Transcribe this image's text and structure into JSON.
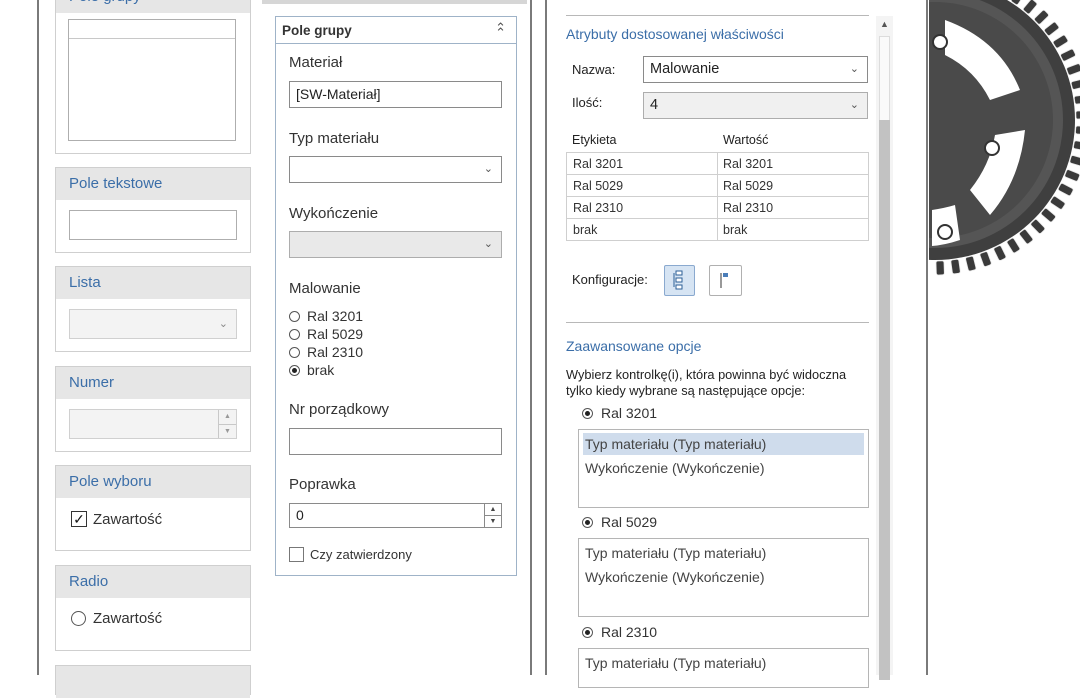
{
  "left_palette": {
    "group_title": "Pole grupy",
    "textbox_title": "Pole tekstowe",
    "list_title": "Lista",
    "number_title": "Numer",
    "checkbox_title": "Pole wyboru",
    "checkbox_label": "Zawartość",
    "radio_title": "Radio",
    "radio_label": "Zawartość"
  },
  "group": {
    "title": "Pole grupy",
    "material_label": "Materiał",
    "material_value": "[SW-Materiał]",
    "material_type_label": "Typ materiału",
    "material_type_value": "",
    "finish_label": "Wykończenie",
    "finish_value": "",
    "painting_label": "Malowanie",
    "painting_options": [
      "Ral 3201",
      "Ral 5029",
      "Ral 2310",
      "brak"
    ],
    "painting_selected": "brak",
    "order_label": "Nr porządkowy",
    "order_value": "",
    "revision_label": "Poprawka",
    "revision_value": "0",
    "approved_label": "Czy zatwierdzony"
  },
  "properties": {
    "attributes_title": "Atrybuty dostosowanej właściwości",
    "name_label": "Nazwa:",
    "name_value": "Malowanie",
    "count_label": "Ilość:",
    "count_value": "4",
    "table_headers": [
      "Etykieta",
      "Wartość"
    ],
    "table_rows": [
      [
        "Ral 3201",
        "Ral 3201"
      ],
      [
        "Ral 5029",
        "Ral 5029"
      ],
      [
        "Ral 2310",
        "Ral 2310"
      ],
      [
        "brak",
        "brak"
      ]
    ],
    "config_label": "Konfiguracje:",
    "advanced_title": "Zaawansowane opcje",
    "advanced_desc_1": "Wybierz kontrolkę(i), która powinna być widoczna",
    "advanced_desc_2": "tylko kiedy wybrane są następujące opcje:",
    "options": [
      {
        "label": "Ral 3201",
        "items": [
          "Typ materiału (Typ materiału)",
          "Wykończenie (Wykończenie)"
        ]
      },
      {
        "label": "Ral 5029",
        "items": [
          "Typ materiału (Typ materiału)",
          "Wykończenie (Wykończenie)"
        ]
      },
      {
        "label": "Ral 2310",
        "items": [
          "Typ materiału (Typ materiału)"
        ]
      }
    ]
  },
  "colors": {
    "accent": "#3b6ea8",
    "header_bg": "#e6e6e6",
    "selection": "#cfdcec"
  }
}
